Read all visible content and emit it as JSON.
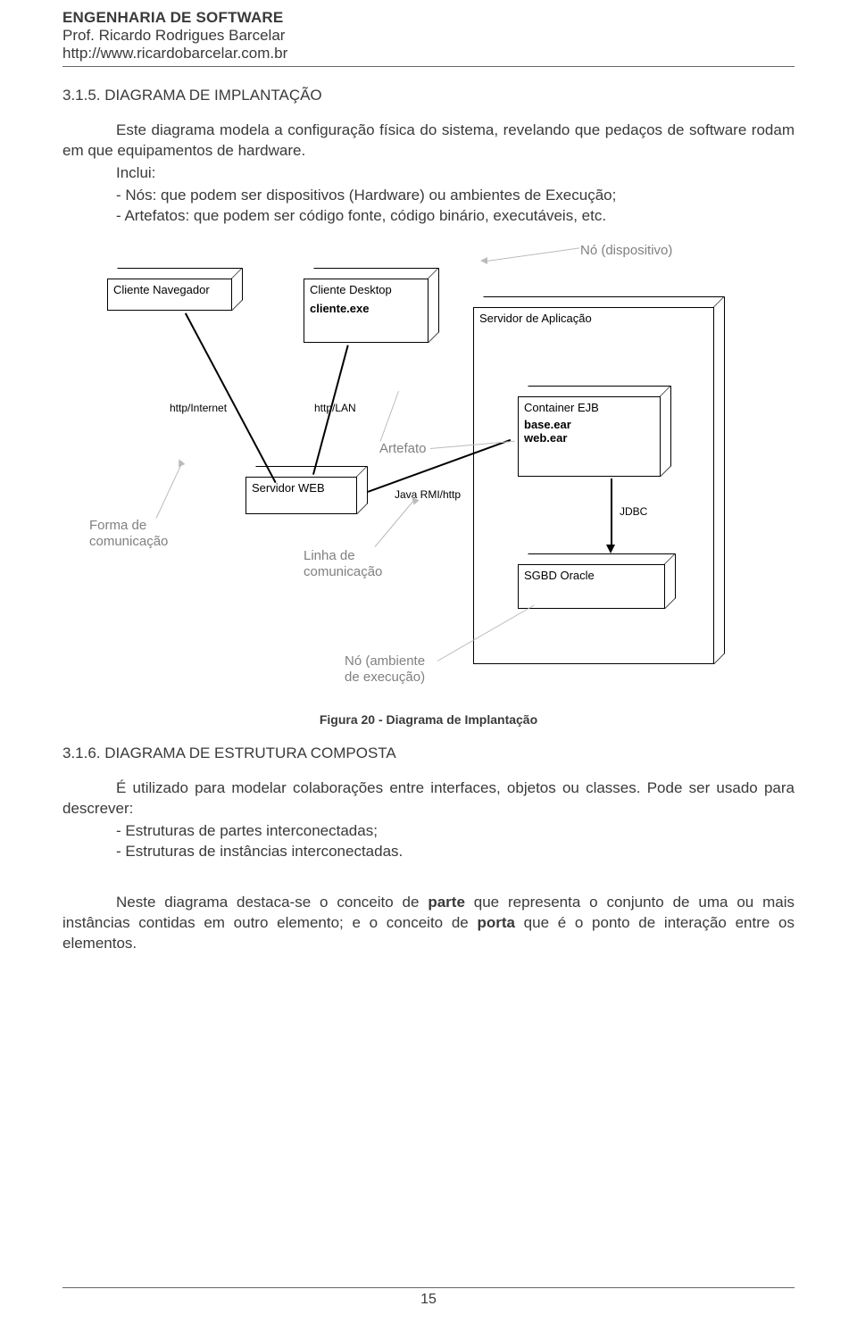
{
  "header": {
    "course": "ENGENHARIA DE SOFTWARE",
    "prof": "Prof. Ricardo Rodrigues Barcelar",
    "url": "http://www.ricardobarcelar.com.br"
  },
  "section315": {
    "title": "3.1.5. DIAGRAMA DE IMPLANTAÇÃO",
    "para1": "Este diagrama modela a configuração física do sistema, revelando que pedaços de software rodam em que equipamentos de hardware.",
    "includes_label": "Inclui:",
    "bullet1": "- Nós: que podem ser dispositivos (Hardware) ou ambientes de Execução;",
    "bullet2": "- Artefatos: que podem ser código fonte, código binário, executáveis, etc."
  },
  "figure": {
    "caption": "Figura 20 - Diagrama de Implantação",
    "nodes": {
      "clienteNavegador": "Cliente Navegador",
      "clienteDesktop": "Cliente Desktop",
      "clienteExe": "cliente.exe",
      "servidorAplicacao": "Servidor de Aplicação",
      "containerEJB": "Container EJB",
      "baseEar": "base.ear",
      "webEar": "web.ear",
      "servidorWEB": "Servidor WEB",
      "sgbdOracle": "SGBD Oracle"
    },
    "edges": {
      "httpInternet": "http/Internet",
      "httpLAN": "http/LAN",
      "javaRMI": "Java RMI/http",
      "jdbc": "JDBC"
    },
    "annotations": {
      "noDispositivo": "Nó (dispositivo)",
      "artefato": "Artefato",
      "formaComunicacao1": "Forma de",
      "formaComunicacao2": "comunicação",
      "linhaComunicacao1": "Linha de",
      "linhaComunicacao2": "comunicação",
      "noAmbiente1": "Nó (ambiente",
      "noAmbiente2": "de execução)"
    }
  },
  "section316": {
    "title": "3.1.6. DIAGRAMA DE ESTRUTURA COMPOSTA",
    "para1": "É utilizado para modelar colaborações entre interfaces, objetos ou classes. Pode ser usado para descrever:",
    "bullet1": "- Estruturas de partes interconectadas;",
    "bullet2": "- Estruturas de instâncias interconectadas.",
    "para2_a": "Neste diagrama destaca-se o conceito de ",
    "para2_b": "parte",
    "para2_c": " que representa o conjunto de uma ou mais instâncias contidas em outro elemento; e o conceito de ",
    "para2_d": "porta",
    "para2_e": " que é o ponto de interação entre os elementos."
  },
  "footer": {
    "page": "15"
  }
}
